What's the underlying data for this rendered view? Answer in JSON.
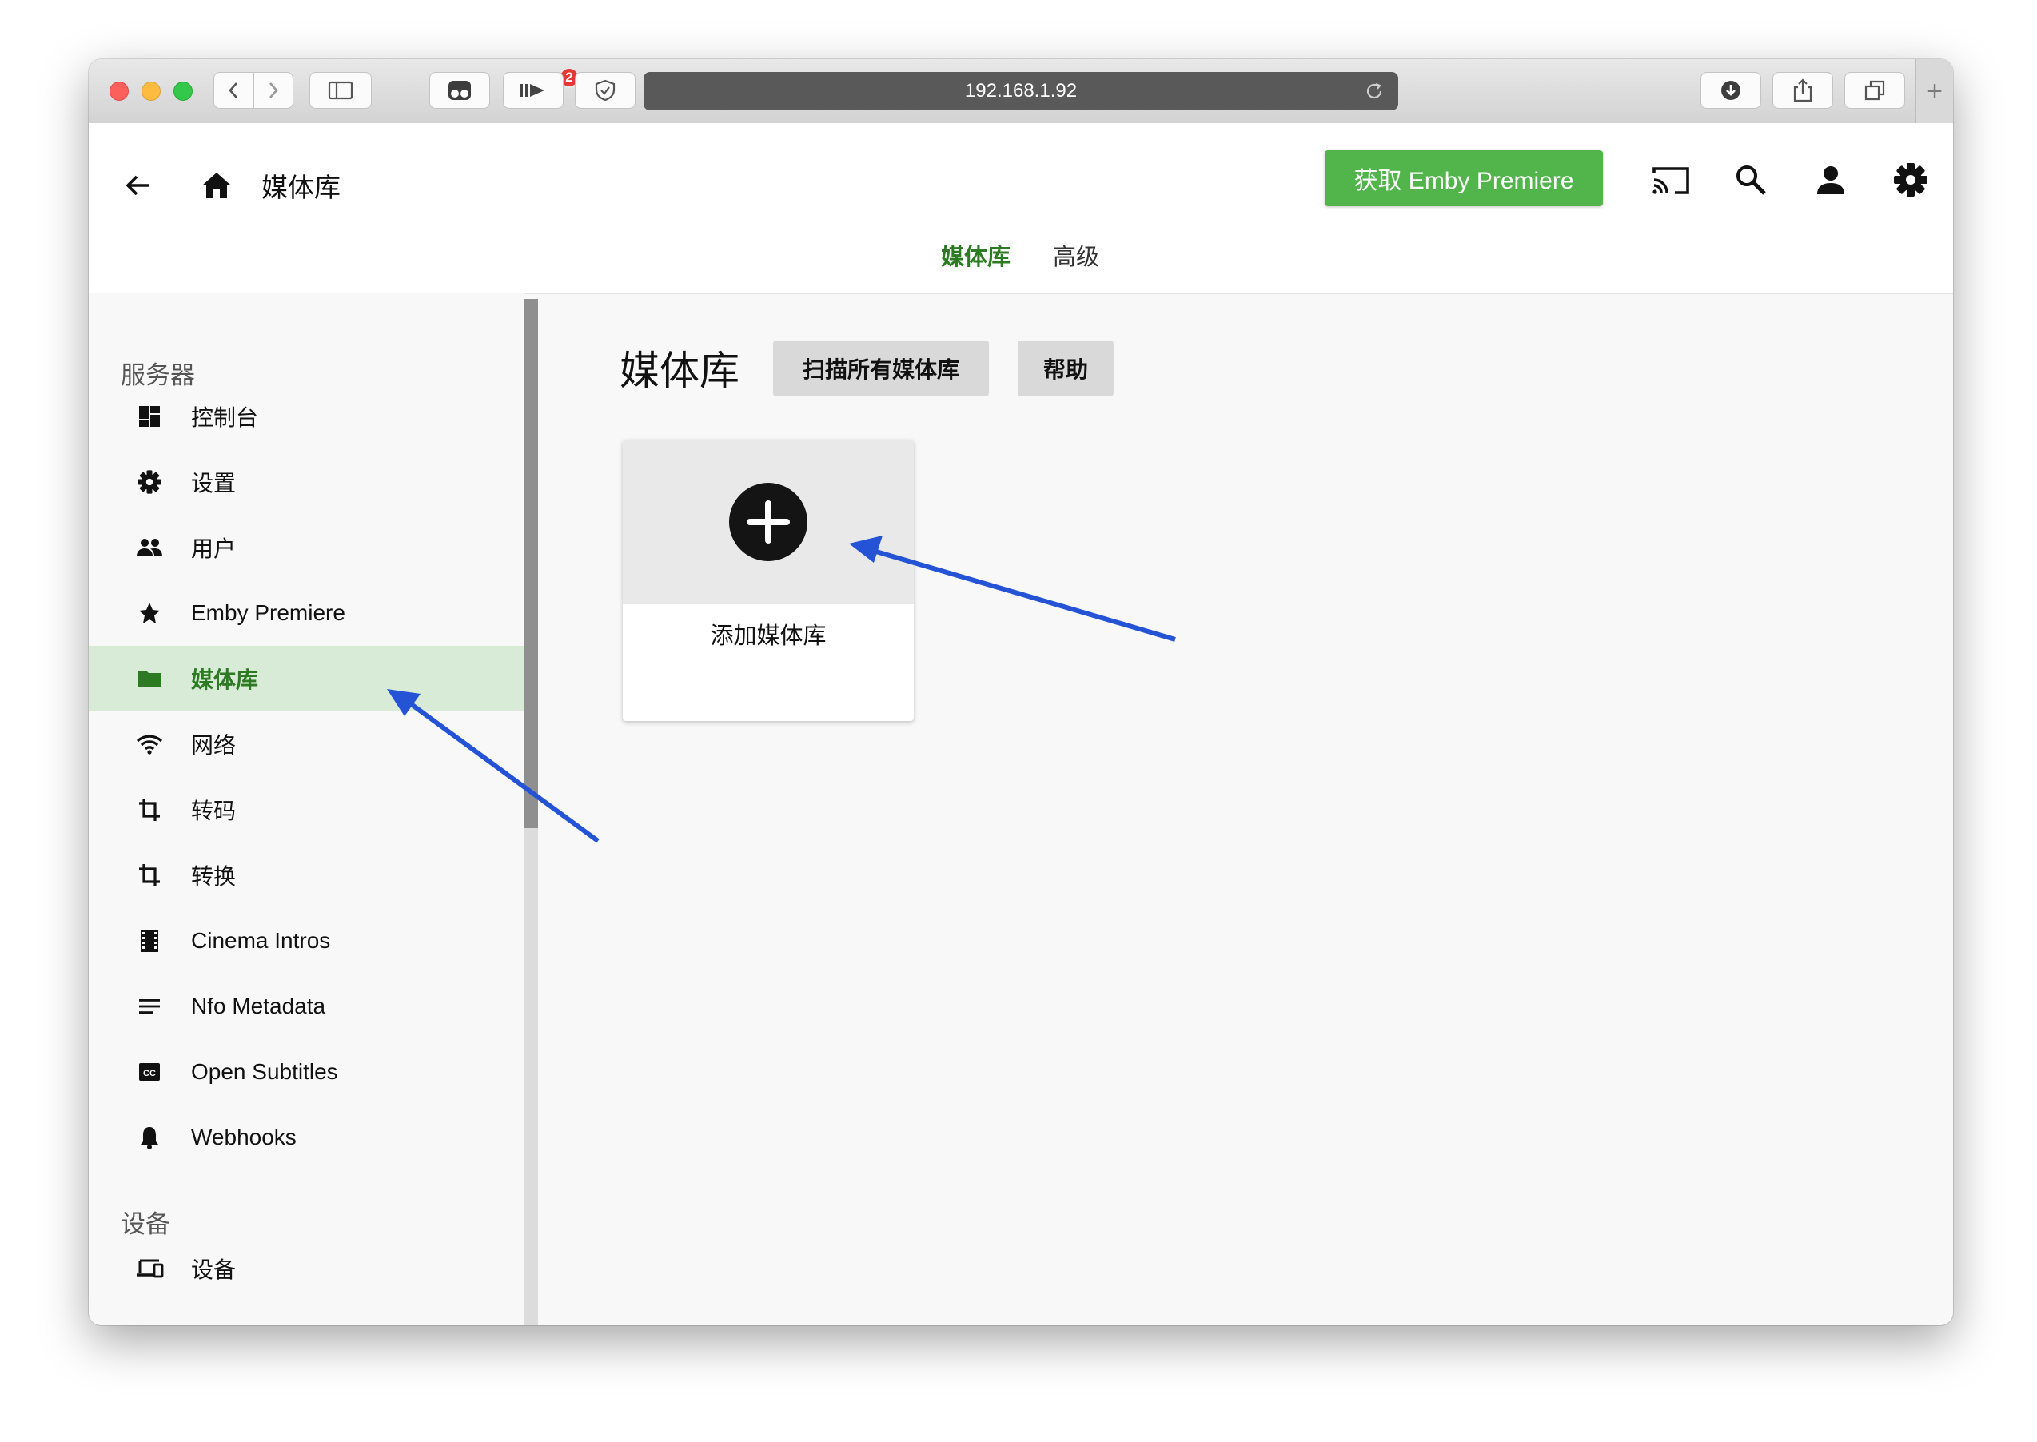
{
  "browser": {
    "url": "192.168.1.92",
    "extension_badge": "2"
  },
  "header": {
    "title": "媒体库",
    "premiere_button": "获取 Emby Premiere",
    "tabs": [
      {
        "label": "媒体库",
        "active": true
      },
      {
        "label": "高级",
        "active": false
      }
    ]
  },
  "sidebar": {
    "section_server": "服务器",
    "items": [
      {
        "label": "控制台",
        "icon": "dashboard-icon"
      },
      {
        "label": "设置",
        "icon": "gear-icon"
      },
      {
        "label": "用户",
        "icon": "people-icon"
      },
      {
        "label": "Emby Premiere",
        "icon": "star-icon"
      },
      {
        "label": "媒体库",
        "icon": "folder-icon",
        "active": true
      },
      {
        "label": "网络",
        "icon": "wifi-icon"
      },
      {
        "label": "转码",
        "icon": "crop-icon"
      },
      {
        "label": "转换",
        "icon": "crop-icon"
      },
      {
        "label": "Cinema Intros",
        "icon": "film-icon"
      },
      {
        "label": "Nfo Metadata",
        "icon": "lines-icon"
      },
      {
        "label": "Open Subtitles",
        "icon": "cc-icon"
      },
      {
        "label": "Webhooks",
        "icon": "bell-icon"
      }
    ],
    "section_devices": "设备",
    "device_item": {
      "label": "设备",
      "icon": "devices-icon"
    }
  },
  "main": {
    "title": "媒体库",
    "scan_button": "扫描所有媒体库",
    "help_button": "帮助",
    "add_card_label": "添加媒体库"
  },
  "colors": {
    "accent_green": "#52b54b",
    "active_text": "#2c7a22",
    "active_bg": "#d7ebd6",
    "annotation_arrow": "#2453d6"
  }
}
